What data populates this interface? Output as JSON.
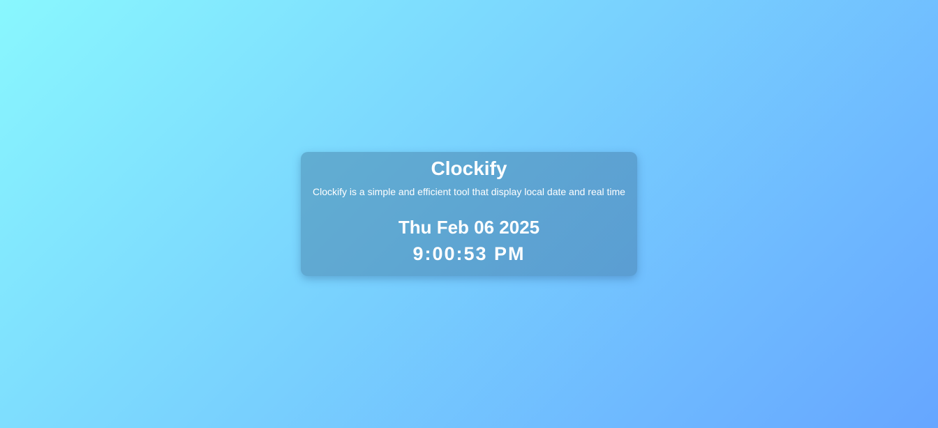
{
  "app": {
    "title": "Clockify",
    "description": "Clockify is a simple and efficient tool that display local date and real time"
  },
  "clock": {
    "date": "Thu Feb 06 2025",
    "time": "9:00:53 PM"
  },
  "colors": {
    "gradient_start": "#89f7fe",
    "gradient_end": "#66a6ff",
    "text": "#ffffff"
  }
}
